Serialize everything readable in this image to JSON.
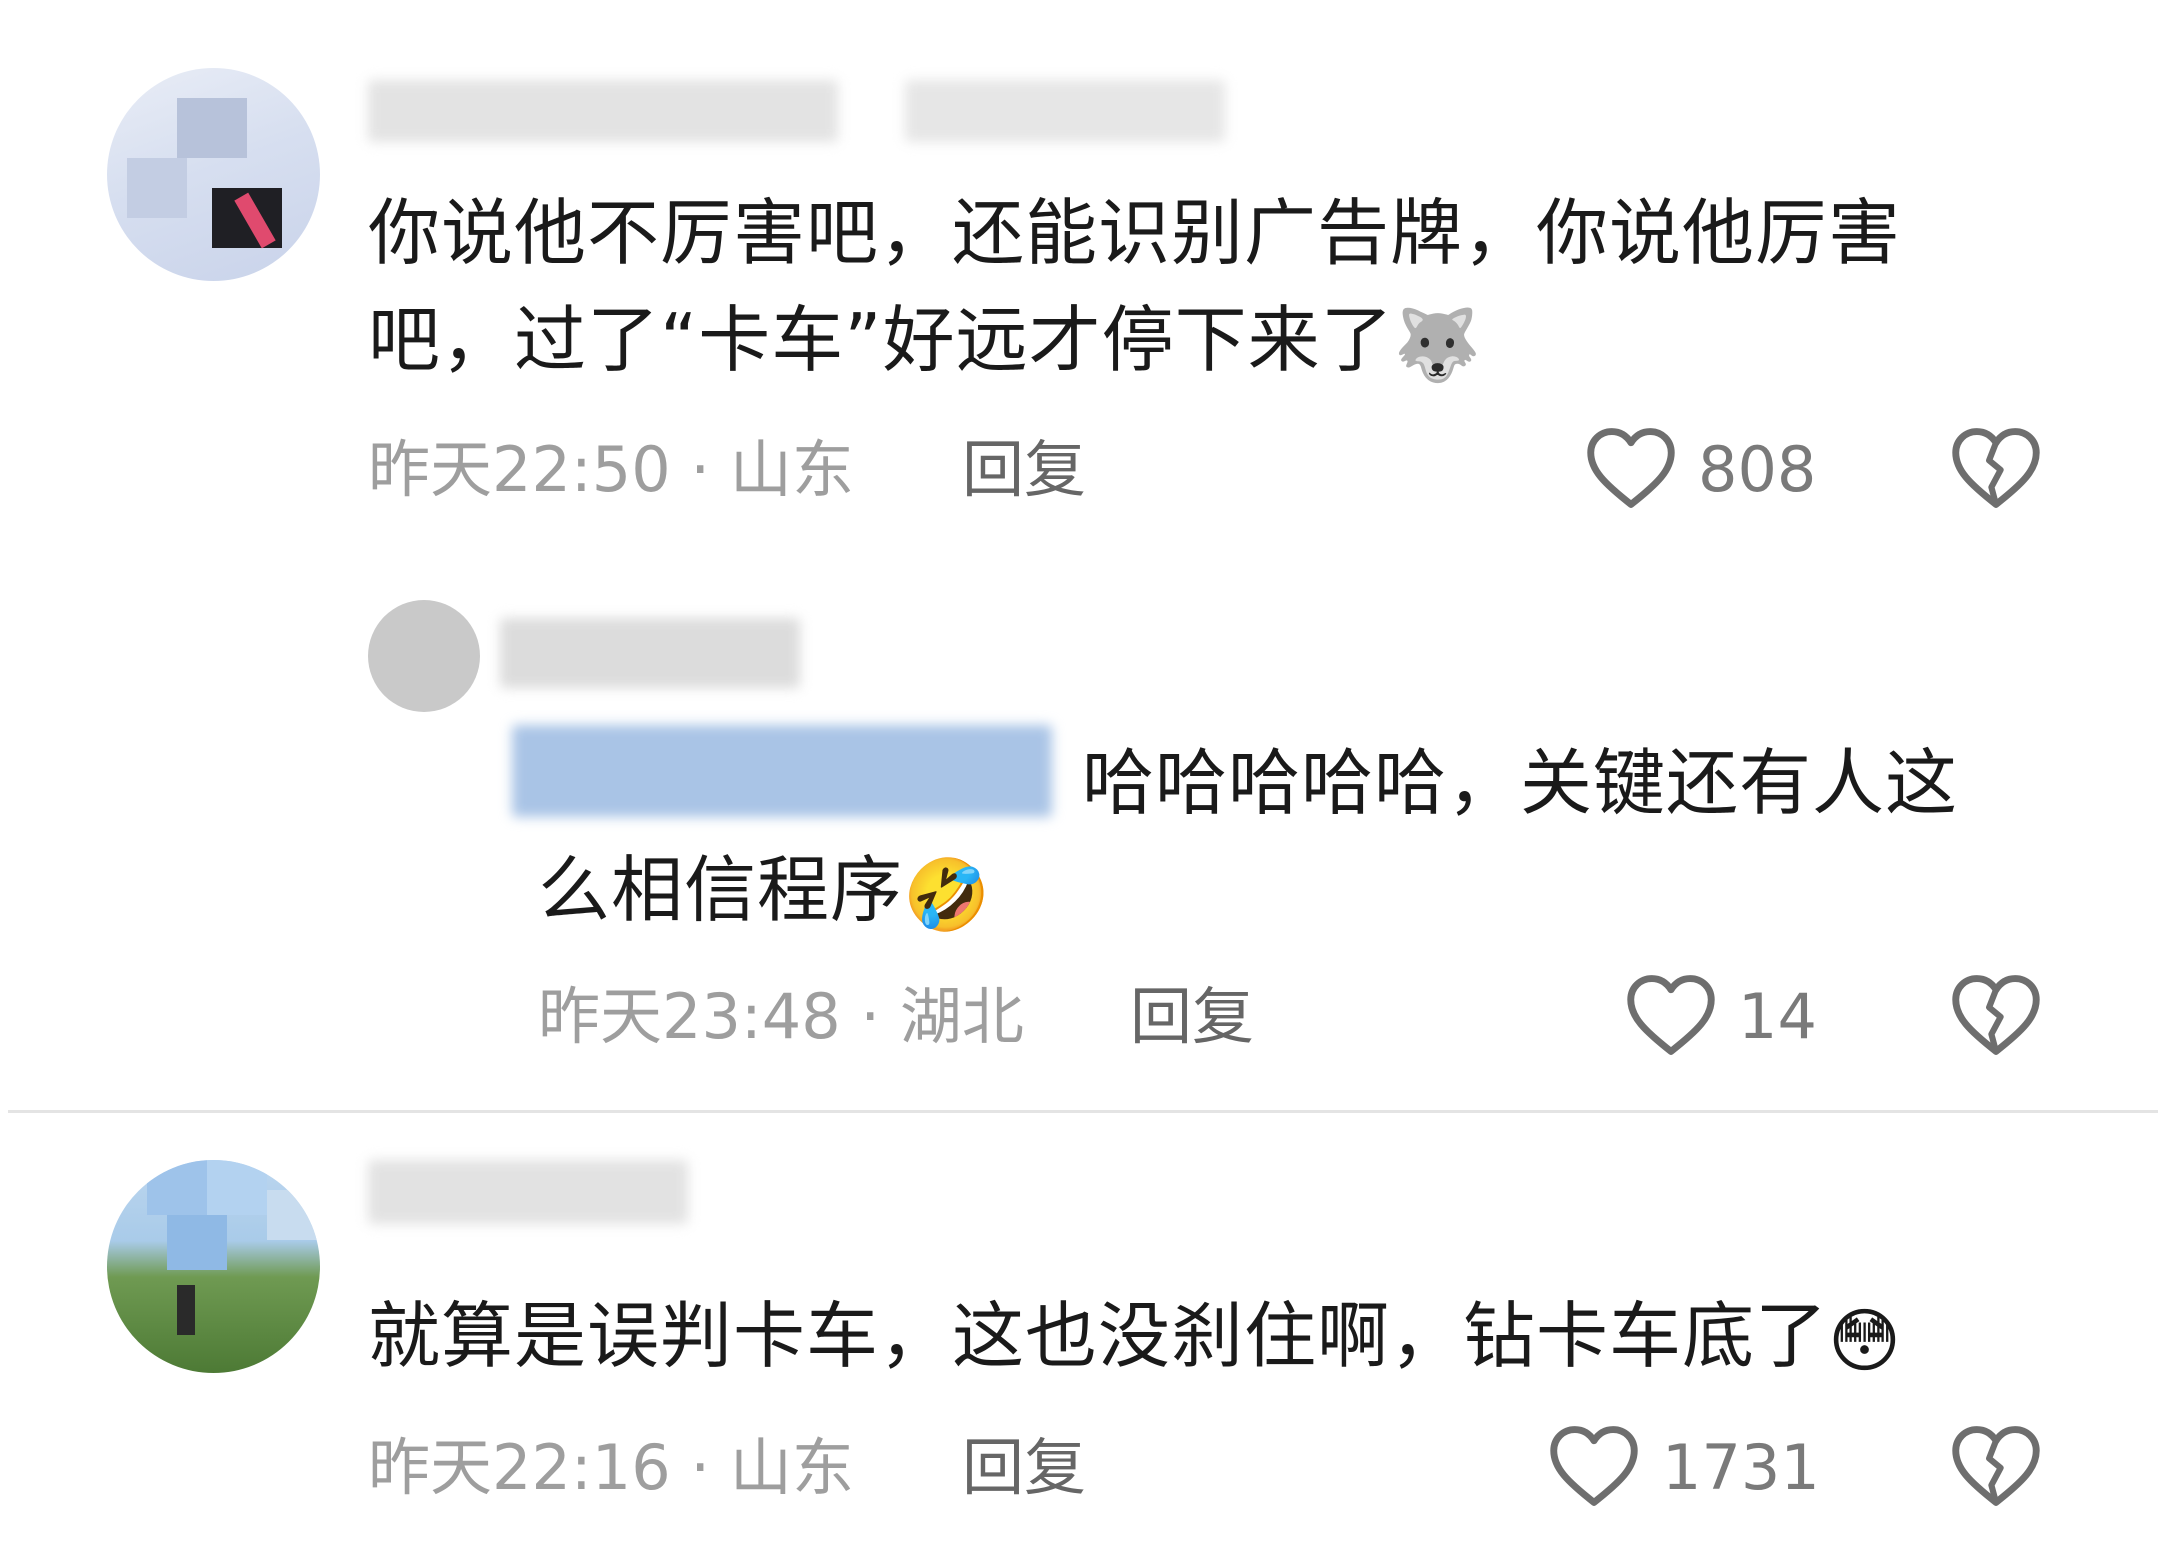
{
  "comments": [
    {
      "text_line1": "你说他不厉害吧，还能识别广告牌，你说他厉害",
      "text_line2": "吧，过了“卡车”好远才停下来了",
      "emoji_name": "dog-face",
      "emoji": "🐺",
      "time": "昨天22:50",
      "location": "山东",
      "reply_label": "回复",
      "likes": "808"
    },
    {
      "text_line1": "哈哈哈哈哈，关键还有人这",
      "text_line2": "么相信程序",
      "emoji_name": "rolling-laughing-face",
      "emoji": "🤣",
      "time": "昨天23:48",
      "location": "湖北",
      "reply_label": "回复",
      "likes": "14"
    },
    {
      "text_line1": "就算是误判卡车，这也没刹住啊，钻卡车底了",
      "emoji_name": "flushed-face",
      "emoji": "😳",
      "time": "昨天22:16",
      "location": "山东",
      "reply_label": "回复",
      "likes": "1731"
    }
  ],
  "separator": "·",
  "colors": {
    "text": "#1a1a1a",
    "meta": "#9e9e9e",
    "reply": "#666666",
    "mention_blur": "#a9c4e6"
  },
  "icons": [
    "heart-outline-icon",
    "broken-heart-icon"
  ]
}
